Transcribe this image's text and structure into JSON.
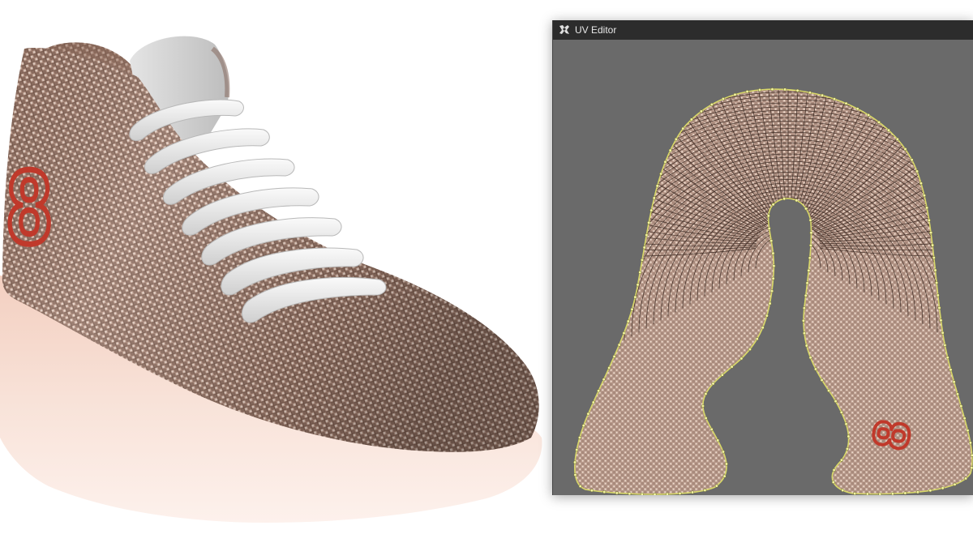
{
  "viewport": {
    "model": "sneaker",
    "logo_glyph": "8",
    "colors": {
      "fabric": "#8f6f61",
      "fabric_dark": "#5f4438",
      "fabric_light": "#c9ad9e",
      "laces": "#eeeeee",
      "sole": "#f6d9cc",
      "logo": "#c0392b"
    }
  },
  "uv_editor": {
    "title": "UV Editor",
    "icon": "uv-editor-app-icon",
    "logo_glyph": "8",
    "colors": {
      "background": "#6a6a6a",
      "titlebar": "#2c2c2c",
      "island_fill": "#a88a7c",
      "wireframe": "#2a1a14",
      "boundary": "#d8d868",
      "vertex": "#f2f2a0",
      "logo": "#c0392b"
    }
  }
}
